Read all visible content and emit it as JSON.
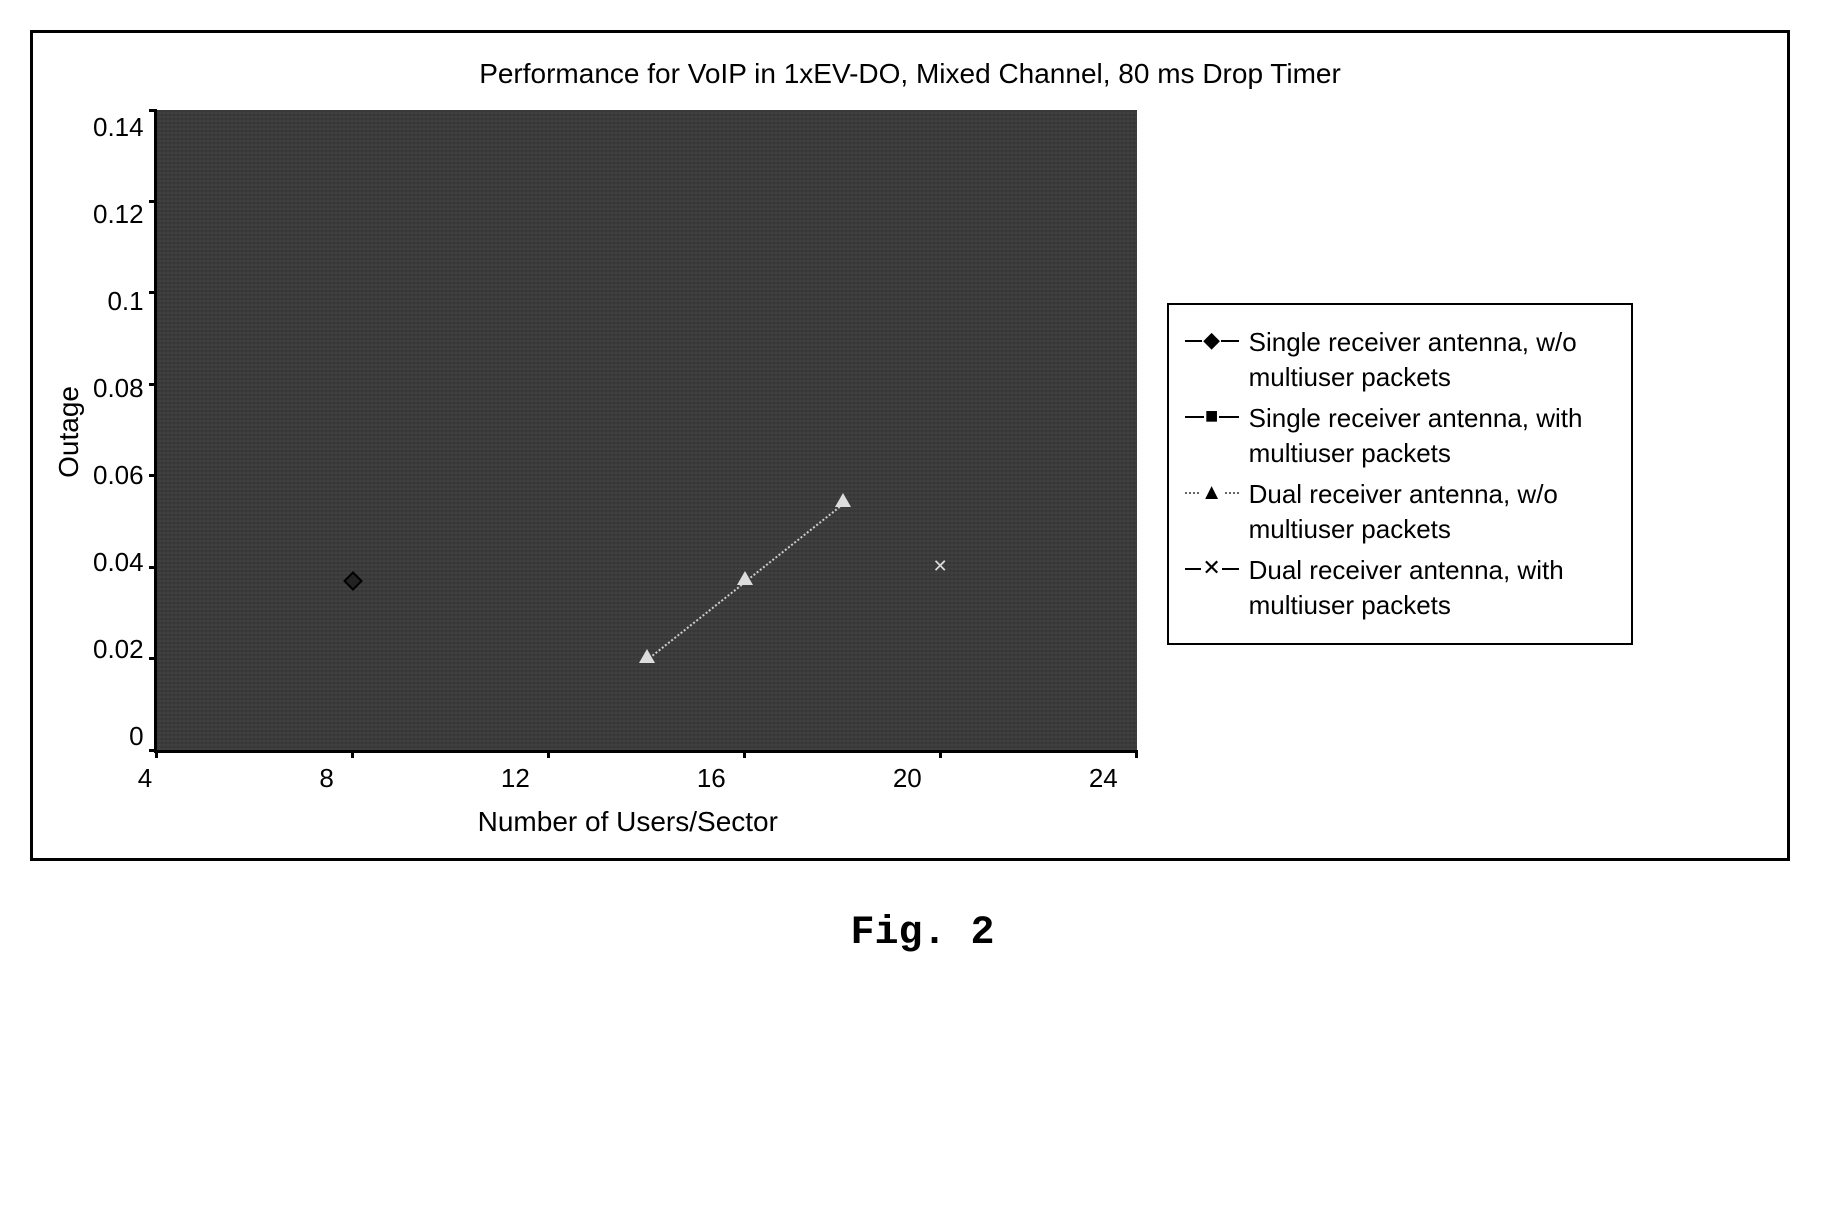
{
  "chart_data": {
    "type": "line",
    "title": "Performance for VoIP in 1xEV-DO, Mixed Channel, 80 ms Drop Timer",
    "xlabel": "Number of Users/Sector",
    "ylabel": "Outage",
    "xlim": [
      4,
      24
    ],
    "ylim": [
      0,
      0.14
    ],
    "x_ticks": [
      4,
      8,
      12,
      16,
      20,
      24
    ],
    "y_ticks": [
      0,
      0.02,
      0.04,
      0.06,
      0.08,
      0.1,
      0.12,
      0.14
    ],
    "series": [
      {
        "name": "Single receiver antenna, w/o multiuser packets",
        "marker": "diamond",
        "line_style": "solid",
        "x": [
          8
        ],
        "y": [
          0.037
        ]
      },
      {
        "name": "Single receiver antenna, with multiuser packets",
        "marker": "square",
        "line_style": "solid",
        "x": [],
        "y": []
      },
      {
        "name": "Dual receiver antenna, w/o multiuser packets",
        "marker": "triangle",
        "line_style": "dotted",
        "x": [
          14,
          16,
          18
        ],
        "y": [
          0.02,
          0.037,
          0.054
        ]
      },
      {
        "name": "Dual receiver antenna, with multiuser packets",
        "marker": "x",
        "line_style": "solid",
        "x": [
          20
        ],
        "y": [
          0.04
        ]
      }
    ]
  },
  "figure_caption": "Fig. 2",
  "legend_markers": {
    "diamond": "◆",
    "square": "■",
    "triangle": "▲",
    "x": "✕"
  }
}
